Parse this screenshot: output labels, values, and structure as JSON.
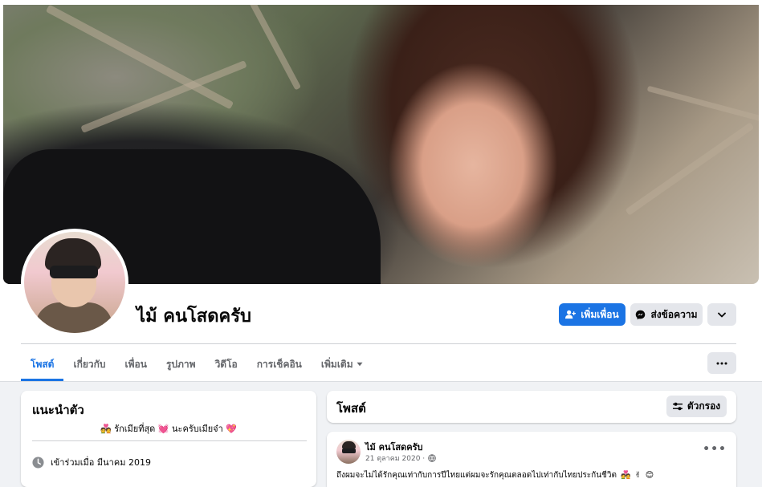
{
  "profile": {
    "name": "ไม้ คนโสดครับ",
    "add_friend_label": "เพิ่มเพื่อน",
    "message_label": "ส่งข้อความ"
  },
  "tabs": [
    {
      "label": "โพสต์",
      "active": true
    },
    {
      "label": "เกี่ยวกับ",
      "active": false
    },
    {
      "label": "เพื่อน",
      "active": false
    },
    {
      "label": "รูปภาพ",
      "active": false
    },
    {
      "label": "วิดีโอ",
      "active": false
    },
    {
      "label": "การเช็คอิน",
      "active": false
    },
    {
      "label": "เพิ่มเติม",
      "active": false
    }
  ],
  "intro": {
    "title": "แนะนำตัว",
    "bio_text": "รักเมียที่สุด",
    "bio_text2": "นะครับเมียจ๋า",
    "joined": "เข้าร่วมเมื่อ มีนาคม 2019"
  },
  "posts": {
    "title": "โพสต์",
    "filter_label": "ตัวกรอง"
  },
  "post": {
    "author": "ไม้ คนโสดครับ",
    "date": "21 ตุลาคม 2020 ·",
    "text": "ถึงผมจะไม่ได้รักคุณเท่ากับการปีไทยแต่ผมจะรักคุณตลอดไปเท่ากับไทยประกันชีวิต"
  },
  "colors": {
    "accent": "#1b74e4",
    "background": "#f0f2f5",
    "secondary_button": "#e4e6eb",
    "muted_text": "#65676b"
  }
}
